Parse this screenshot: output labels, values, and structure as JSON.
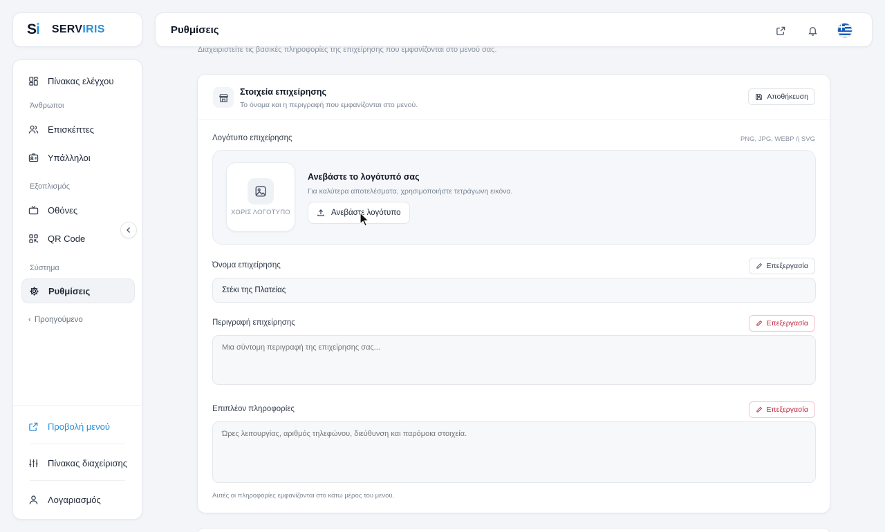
{
  "brand": {
    "mark_s": "S",
    "mark_i": "i",
    "name_a": "SERV",
    "name_b": "IRIS",
    "accent": "#2b8fd8"
  },
  "sidebar": {
    "items": [
      {
        "label": "Πίνακας ελέγχου",
        "icon": "dashboard-icon"
      },
      {
        "label": "Επισκέπτες",
        "icon": "users-icon"
      },
      {
        "label": "Υπάλληλοι",
        "icon": "badge-icon"
      },
      {
        "label": "Οθόνες",
        "icon": "tv-icon"
      },
      {
        "label": "QR Code",
        "icon": "qr-icon"
      },
      {
        "label": "Ρυθμίσεις",
        "icon": "gear-icon"
      }
    ],
    "groups": {
      "people": "Άνθρωποι",
      "equipment": "Εξοπλισμός",
      "system": "Σύστημα"
    },
    "previous_label": "Προηγούμενο",
    "bottom": {
      "view_menu": "Προβολή μενού",
      "admin_panel": "Πίνακας διαχείρισης",
      "account": "Λογαριασμός"
    }
  },
  "header": {
    "title": "Ρυθμίσεις",
    "subtitle": "Διαχειριστείτε τις βασικές πληροφορίες της επιχείρησης που εμφανίζονται στο μενού σας."
  },
  "section": {
    "title": "Στοιχεία επιχείρησης",
    "description": "Το όνομα και η περιγραφή που εμφανίζονται στο μενού.",
    "save_label": "Αποθήκευση"
  },
  "logo_field": {
    "label": "Λογότυπο επιχείρησης",
    "formats": "PNG, JPG, WEBP ή SVG",
    "placeholder_text": "ΧΩΡΙΣ ΛΟΓΟΤΥΠΟ",
    "upload_title": "Ανεβάστε το λογότυπό σας",
    "upload_desc": "Για καλύτερα αποτελέσματα, χρησιμοποιήστε τετράγωνη εικόνα.",
    "upload_button": "Ανεβάστε λογότυπο"
  },
  "name_field": {
    "label": "Όνομα επιχείρησης",
    "edit_label": "Επεξεργασία",
    "value": "Στέκι της Πλατείας"
  },
  "description_field": {
    "label": "Περιγραφή επιχείρησης",
    "edit_label": "Επεξεργασία",
    "placeholder": "Μια σύντομη περιγραφή της επιχείρησης σας..."
  },
  "extra_field": {
    "label": "Επιπλέον πληροφορίες",
    "edit_label": "Επεξεργασία",
    "placeholder": "Ώρες λειτουργίας, αριθμός τηλεφώνου, διεύθυνση και παρόμοια στοιχεία.",
    "footnote": "Αυτές οι πληροφορίες εμφανίζονται στο κάτω μέρος του μενού."
  }
}
